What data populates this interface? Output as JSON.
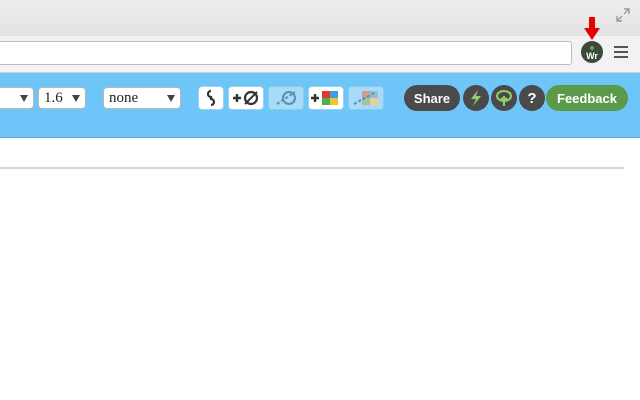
{
  "extension": {
    "icon_text": "Wr",
    "icon_plus": "+"
  },
  "editor_toolbar": {
    "font_size_value": "1.6",
    "font_value": "none",
    "share_label": "Share",
    "help_label": "?",
    "feedback_label": "Feedback"
  },
  "colors": {
    "toolbar_blue": "#6ec6f8",
    "share_bg": "#4a4a4a",
    "feedback_green": "#5a9a4a",
    "arrow_red": "#e60000"
  },
  "icons": [
    "resize-icon",
    "extension-icon",
    "red-arrow-icon",
    "menu-icon",
    "link-icon",
    "add-link-icon",
    "remove-link-icon",
    "add-image-icon",
    "remove-image-icon",
    "lightning-icon",
    "tree-icon",
    "help-icon"
  ]
}
